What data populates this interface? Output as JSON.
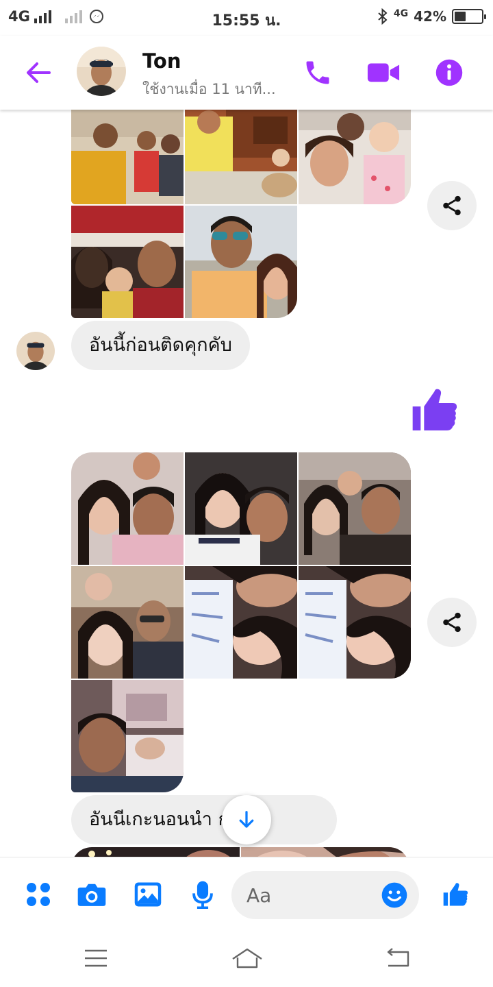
{
  "status_bar": {
    "network": "4G",
    "time": "15:55 น.",
    "network_right": "4G",
    "battery": "42%",
    "battery_level": 0.42
  },
  "header": {
    "contact_name": "Ton",
    "status": "ใช้งานเมื่อ 11 นาที..."
  },
  "messages": {
    "received_1": "อันนี้ก่อนติดคุกคับ",
    "received_2": "อันนีเกะนอนนำ                 กมื้อยุ"
  },
  "composer": {
    "placeholder": "Aa"
  },
  "colors": {
    "accent_purple": "#A033FF",
    "accent_blue": "#0A7CFF",
    "like_purple": "#7B3FF2"
  },
  "icons": {
    "back": "back-arrow-icon",
    "call": "phone-icon",
    "video": "video-camera-icon",
    "info": "info-icon",
    "share": "share-icon",
    "like": "thumbs-up-icon",
    "scroll": "arrow-down-icon",
    "apps": "grid-dots-icon",
    "camera": "camera-icon",
    "gallery": "image-icon",
    "mic": "microphone-icon",
    "emoji": "emoji-icon"
  }
}
